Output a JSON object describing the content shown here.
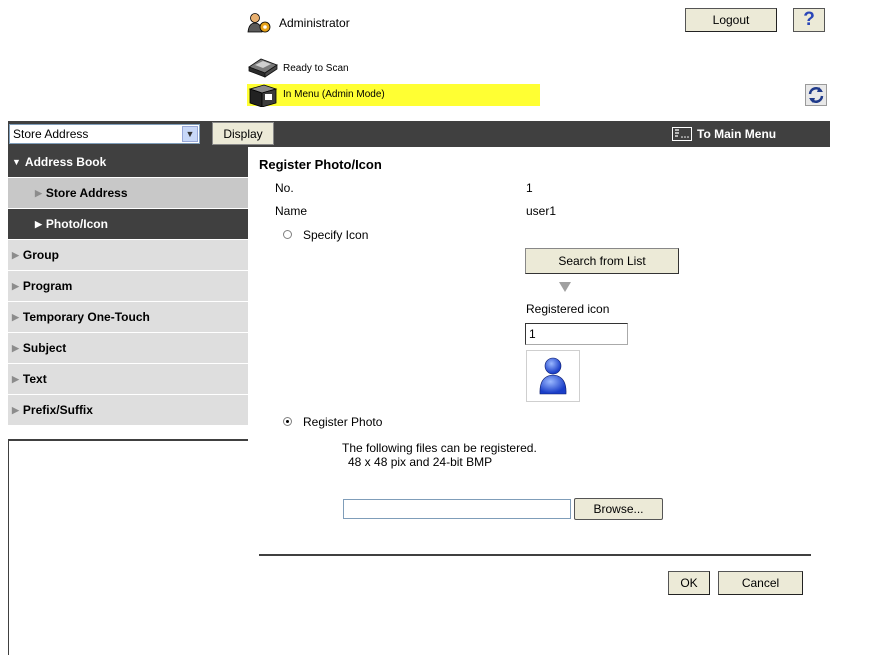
{
  "header": {
    "user_label": "Administrator",
    "logout_label": "Logout",
    "help_label": "?",
    "scan_status": "Ready to Scan",
    "mode_status": "In Menu (Admin Mode)"
  },
  "toolbar": {
    "select_value": "Store Address",
    "display_label": "Display",
    "main_menu_label": "To Main Menu"
  },
  "sidebar": {
    "items": [
      {
        "label": "Address Book"
      },
      {
        "label": "Store Address"
      },
      {
        "label": "Photo/Icon"
      },
      {
        "label": "Group"
      },
      {
        "label": "Program"
      },
      {
        "label": "Temporary One-Touch"
      },
      {
        "label": "Subject"
      },
      {
        "label": "Text"
      },
      {
        "label": "Prefix/Suffix"
      }
    ]
  },
  "main": {
    "title": "Register Photo/Icon",
    "no_label": "No.",
    "no_value": "1",
    "name_label": "Name",
    "name_value": "user1",
    "specify_icon_label": "Specify Icon",
    "search_button_label": "Search from List",
    "registered_icon_label": "Registered icon",
    "registered_icon_value": "1",
    "register_photo_label": "Register Photo",
    "info_line1": "The following files can be registered.",
    "info_line2": "48 x 48 pix and 24-bit BMP",
    "browse_label": "Browse...",
    "ok_label": "OK",
    "cancel_label": "Cancel"
  },
  "colors": {
    "status_highlight": "#ffff33",
    "dark_bar": "#404040",
    "button_face": "#ecead7"
  }
}
